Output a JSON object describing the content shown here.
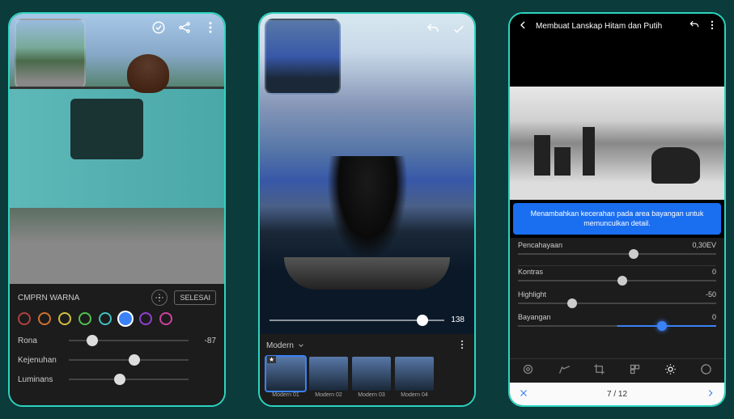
{
  "phone1": {
    "panel_title": "CMPRN WARNA",
    "done_label": "SELESAI",
    "swatches": [
      "#b04040",
      "#d07030",
      "#d0c040",
      "#50c050",
      "#40c0c0",
      "#3b82f6",
      "#9040d0",
      "#d040a0"
    ],
    "selected_swatch": 5,
    "sliders": [
      {
        "label": "Rona",
        "value": "-87",
        "pos": 15
      },
      {
        "label": "Kejenuhan",
        "value": "",
        "pos": 50
      },
      {
        "label": "Luminans",
        "value": "",
        "pos": 38
      }
    ]
  },
  "phone2": {
    "exposure_value": "138",
    "category": "Modern",
    "presets": [
      {
        "label": "Modern 01",
        "selected": true
      },
      {
        "label": "Modern 02",
        "selected": false
      },
      {
        "label": "Modern 03",
        "selected": false
      },
      {
        "label": "Modern 04",
        "selected": false
      }
    ]
  },
  "phone3": {
    "title": "Membuat Lanskap Hitam dan Putih",
    "tip": "Menambahkan kecerahan pada area bayangan untuk memunculkan detail.",
    "sliders": [
      {
        "label": "Pencahayaan",
        "value": "0,30EV",
        "pos": 56,
        "active": false
      },
      {
        "label": "Kontras",
        "value": "0",
        "pos": 50,
        "active": false
      },
      {
        "label": "Highlight",
        "value": "-50",
        "pos": 25,
        "active": false
      },
      {
        "label": "Bayangan",
        "value": "0",
        "pos": 70,
        "active": true
      }
    ],
    "pager": "7 / 12"
  }
}
